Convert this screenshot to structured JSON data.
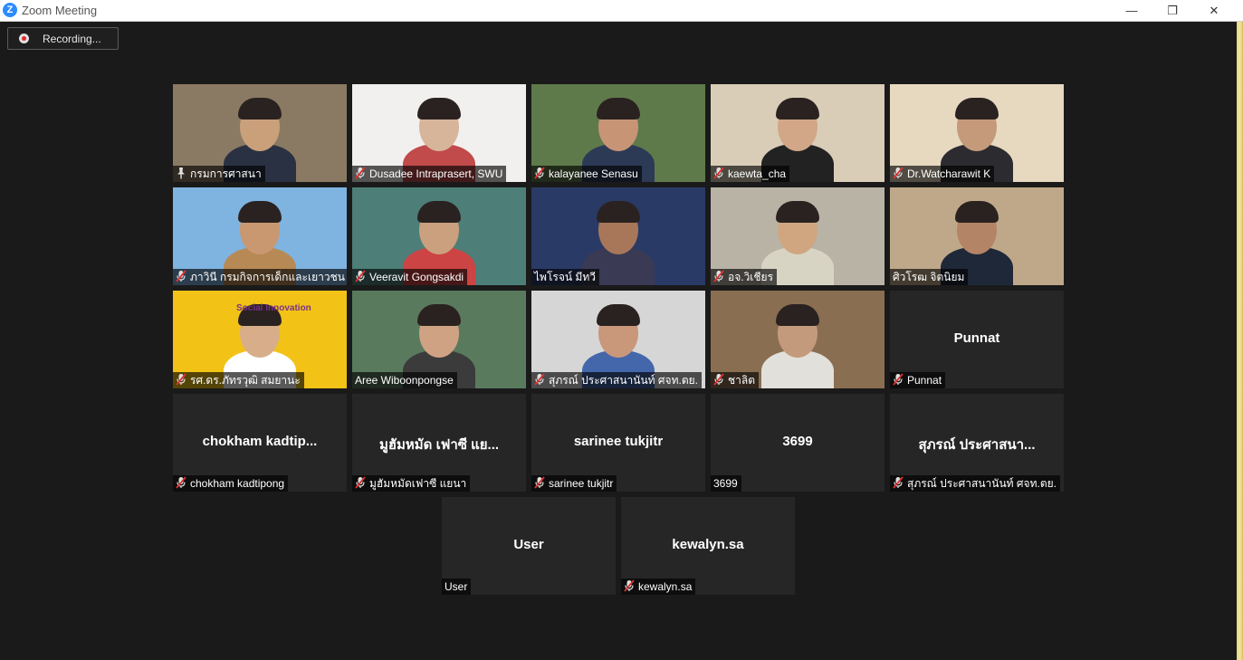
{
  "window": {
    "title": "Zoom Meeting",
    "logo_letter": "Z"
  },
  "controls": {
    "minimize": "—",
    "restore": "❐",
    "close": "✕"
  },
  "recording": {
    "label": "Recording..."
  },
  "participants": [
    {
      "tag": "กรมการศาสนา",
      "big": "",
      "muted": false,
      "pinned": true,
      "video": true,
      "bg": "#8a7a63",
      "skin": "#c9a07a",
      "cloth": "#2a3142"
    },
    {
      "tag": "Dusadee Intraprasert, SWU",
      "big": "",
      "muted": true,
      "video": true,
      "bg": "#f2f0ee",
      "skin": "#d7b59b",
      "cloth": "#c14a4a"
    },
    {
      "tag": "kalayanee Senasu",
      "big": "",
      "muted": true,
      "video": true,
      "bg": "#5f7a4a",
      "skin": "#c89476",
      "cloth": "#2d3a56"
    },
    {
      "tag": "kaewta_cha",
      "big": "",
      "muted": true,
      "video": true,
      "bg": "#d9cdb8",
      "skin": "#d1a787",
      "cloth": "#222222"
    },
    {
      "tag": "Dr.Watcharawit K",
      "big": "",
      "muted": true,
      "video": true,
      "bg": "#e6d9c0",
      "skin": "#c49a7a",
      "cloth": "#2b2b30"
    },
    {
      "tag": "ภาวินี กรมกิจการเด็กและเยาวชน",
      "big": "",
      "muted": true,
      "video": true,
      "bg": "#7fb3e0",
      "skin": "#c99870",
      "cloth": "#b78a55"
    },
    {
      "tag": "Veeravit Gongsakdi",
      "big": "",
      "muted": true,
      "video": true,
      "bg": "#4d7e78",
      "skin": "#caa07e",
      "cloth": "#c44"
    },
    {
      "tag": "ไพโรจน์ มีทวี",
      "big": "",
      "muted": false,
      "video": true,
      "active": true,
      "bg": "#2a3a66",
      "skin": "#a8775a",
      "cloth": "#3a3a55"
    },
    {
      "tag": "อจ.วิเชียร",
      "big": "",
      "muted": true,
      "video": true,
      "bg": "#b9b3a6",
      "skin": "#d0a681",
      "cloth": "#d8d4c4"
    },
    {
      "tag": "ศิวโรฒ จิตนิยม",
      "big": "",
      "muted": false,
      "video": true,
      "bg": "#bfa889",
      "skin": "#b38465",
      "cloth": "#1e2838"
    },
    {
      "tag": "รศ.ดร.ภัทรวุฒิ สมยานะ",
      "big": "",
      "muted": true,
      "video": true,
      "bg": "#f2c316",
      "skin": "#d8ae8a",
      "cloth": "#ffffff",
      "overlay": "Social Innovation"
    },
    {
      "tag": "Aree Wiboonpongse",
      "big": "",
      "muted": false,
      "video": true,
      "bg": "#5a7a5e",
      "skin": "#cfa283",
      "cloth": "#3b3b3b"
    },
    {
      "tag": "สุภรณ์ ประศาสนานันท์ ศจท.ตย.",
      "big": "",
      "muted": true,
      "video": true,
      "bg": "#d6d6d6",
      "skin": "#c9977a",
      "cloth": "#4466aa"
    },
    {
      "tag": "ชาลิต",
      "big": "",
      "muted": true,
      "video": true,
      "bg": "#8a6e52",
      "skin": "#c39a7c",
      "cloth": "#e2e0da"
    },
    {
      "tag": "Punnat",
      "big": "Punnat",
      "muted": true,
      "video": false
    },
    {
      "tag": "chokham kadtipong",
      "big": "chokham  kadtip...",
      "muted": true,
      "video": false
    },
    {
      "tag": "มูฮัมหมัดเฟาซี แยนา",
      "big": "มูฮัมหมัด เฟาซี แย...",
      "muted": true,
      "video": false
    },
    {
      "tag": "sarinee tukjitr",
      "big": "sarinee tukjitr",
      "muted": true,
      "video": false
    },
    {
      "tag": "3699",
      "big": "3699",
      "muted": false,
      "video": false
    },
    {
      "tag": "สุภรณ์ ประศาสนานันท์ ศจท.ตย.",
      "big": "สุภรณ์ ประศาสนา...",
      "muted": true,
      "video": false
    },
    {
      "tag": "User",
      "big": "User",
      "muted": false,
      "video": false
    },
    {
      "tag": "kewalyn.sa",
      "big": "kewalyn.sa",
      "muted": true,
      "video": false
    }
  ]
}
